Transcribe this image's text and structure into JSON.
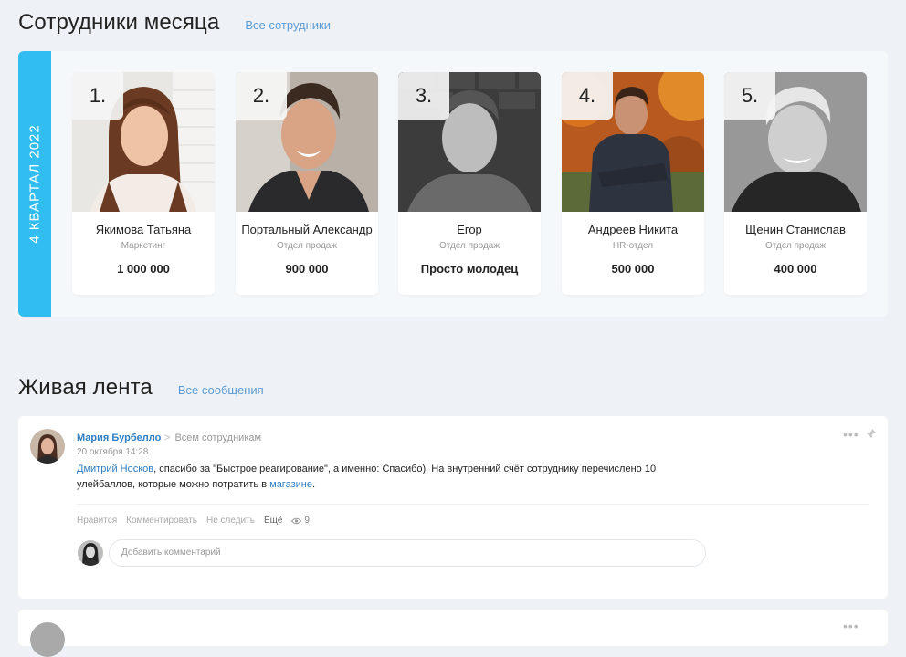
{
  "employees_section": {
    "title": "Сотрудники месяца",
    "link": "Все сотрудники",
    "quarter": "4 КВАРТАЛ 2022",
    "cards": [
      {
        "rank": "1.",
        "name": "Якимова Татьяна",
        "dept": "Маркетинг",
        "score": "1 000 000"
      },
      {
        "rank": "2.",
        "name": "Портальный Александр",
        "dept": "Отдел продаж",
        "score": "900 000"
      },
      {
        "rank": "3.",
        "name": "Егор",
        "dept": "Отдел продаж",
        "score": "Просто молодец"
      },
      {
        "rank": "4.",
        "name": "Андреев Никита",
        "dept": "HR-отдел",
        "score": "500 000"
      },
      {
        "rank": "5.",
        "name": "Щенин Станислав",
        "dept": "Отдел продаж",
        "score": "400 000"
      }
    ]
  },
  "feed_section": {
    "title": "Живая лента",
    "link": "Все сообщения",
    "post": {
      "author": "Мария Бурбелло",
      "target": "Всем сотрудникам",
      "date": "20 октября 14:28",
      "mention": "Дмитрий Носков",
      "text_part1": ", спасибо за \"Быстрое реагирование\", а именно: Спасибо). На внутренний счёт сотруднику перечислено 10 улейбаллов, которые можно потратить в ",
      "shop_link": "магазине",
      "text_end": ".",
      "actions": {
        "like": "Нравится",
        "comment": "Комментировать",
        "unfollow": "Не следить",
        "more": "Ещё"
      },
      "views": "9",
      "comment_placeholder": "Добавить комментарий"
    }
  },
  "colors": {
    "accent_strip": "#32bdf0",
    "link": "#2f7ec2",
    "page_bg": "#eef2f6"
  }
}
